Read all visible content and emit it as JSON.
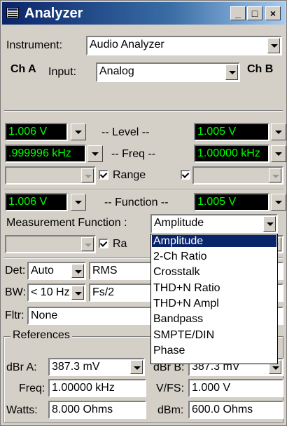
{
  "window": {
    "title": "Analyzer",
    "min_label": "_",
    "max_label": "□",
    "close_label": "×"
  },
  "instrument": {
    "label": "Instrument:",
    "value": "Audio Analyzer"
  },
  "channels": {
    "a": "Ch A",
    "b": "Ch B",
    "input_label": "Input:",
    "input_value": "Analog"
  },
  "meters": {
    "level_label": "-- Level --",
    "level_a": "1.006   V",
    "level_b": "1.005   V",
    "freq_label": "-- Freq --",
    "freq_a": ".999996 kHz",
    "freq_b": "1.00000 kHz",
    "range_label": "Range",
    "function_label": "-- Function --",
    "function_a": "1.006   V",
    "function_b": "1.005   V"
  },
  "measurement": {
    "label": "Measurement Function :",
    "value": "Amplitude",
    "range_label_partial": "Ra"
  },
  "detector": {
    "label": "Det:",
    "value": "Auto",
    "mode": "RMS"
  },
  "bandwidth": {
    "label": "BW:",
    "low": "< 10 Hz",
    "high": "Fs/2"
  },
  "filter": {
    "label": "Fltr:",
    "value": "None"
  },
  "dropdown_options": [
    "Amplitude",
    "2-Ch Ratio",
    "Crosstalk",
    "THD+N Ratio",
    "THD+N Ampl",
    "Bandpass",
    "SMPTE/DIN",
    "Phase"
  ],
  "references": {
    "title": "References",
    "dbra_label": "dBr A:",
    "dbra_value": "387.3   mV",
    "dbrb_label": "dBr B:",
    "dbrb_value": "387.3   mV",
    "freq_label": "Freq:",
    "freq_value": "1.00000 kHz",
    "vfs_label": "V/FS:",
    "vfs_value": "1.000    V",
    "watts_label": "Watts:",
    "watts_value": "8.000    Ohms",
    "dbm_label": "dBm:",
    "dbm_value": "600.0    Ohms"
  }
}
